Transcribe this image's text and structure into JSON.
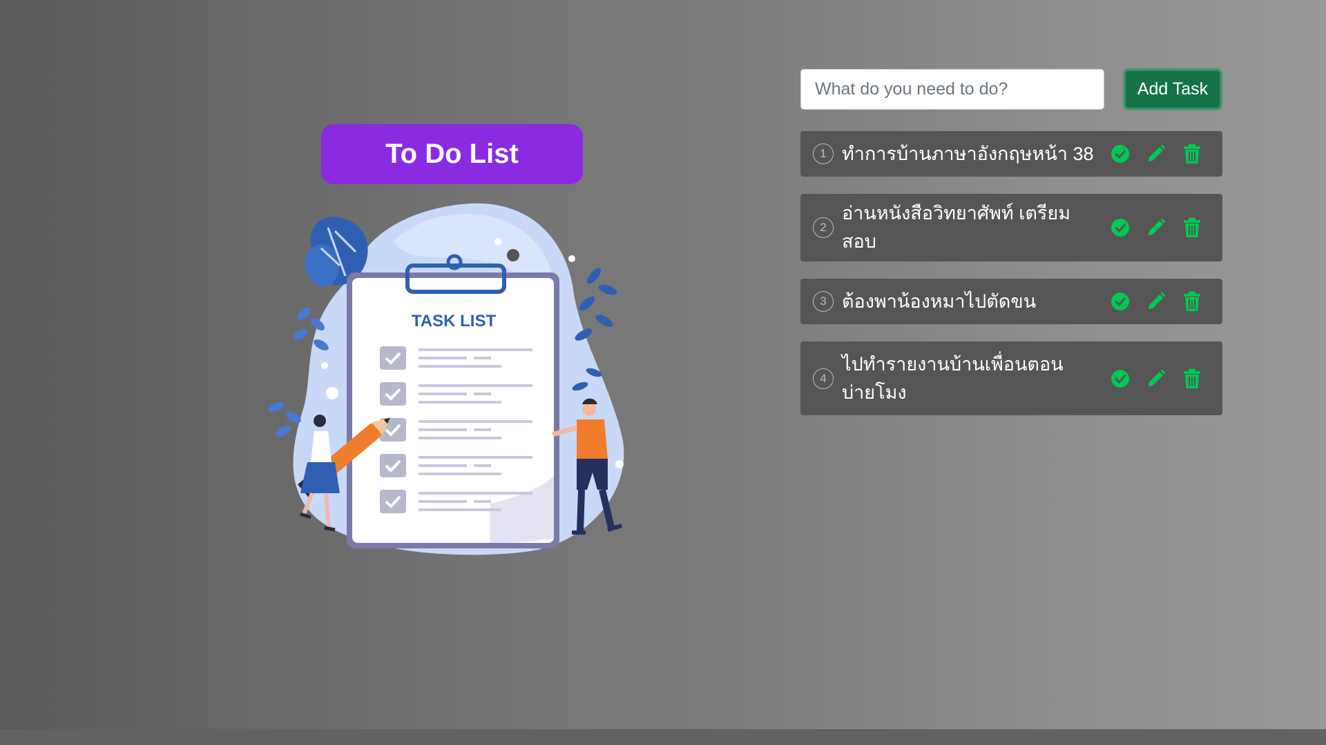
{
  "app": {
    "title": "To Do List"
  },
  "illustration": {
    "icon": "task-list-illustration",
    "text": "TASK LIST"
  },
  "form": {
    "placeholder": "What do you need to do?",
    "value": "",
    "add_label": "Add Task"
  },
  "tasks": [
    {
      "number": "1",
      "text": "ทำการบ้านภาษาอังกฤษหน้า 38"
    },
    {
      "number": "2",
      "text": "อ่านหนังสือวิทยาศัพท์ เตรียมสอบ"
    },
    {
      "number": "3",
      "text": "ต้องพาน้องหมาไปตัดขน"
    },
    {
      "number": "4",
      "text": "ไปทำรายงานบ้านเพื่อนตอนบ่ายโมง"
    }
  ],
  "icons": {
    "complete": "check-circle-icon",
    "edit": "pencil-icon",
    "delete": "trash-icon"
  },
  "colors": {
    "title_bg": "#8a2be2",
    "add_button_bg": "#157347",
    "task_bg": "#555555",
    "action_icon": "#00c853"
  }
}
